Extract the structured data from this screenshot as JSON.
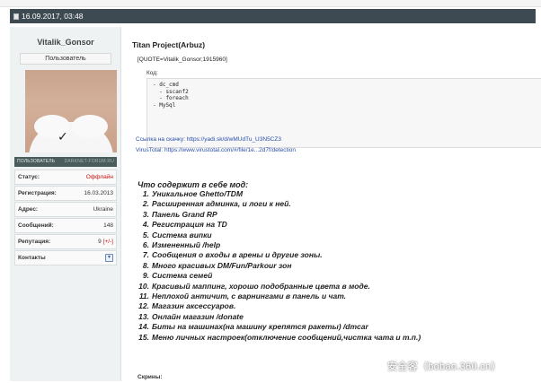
{
  "post_header": {
    "datetime": "16.09.2017, 03:48"
  },
  "user": {
    "name": "Vitalik_Gonsor",
    "role": "Пользователь",
    "banner": {
      "label": "ПОЛЬЗОВАТЕЛЬ",
      "brand": "DARKNET-FORUM.RU"
    },
    "info": [
      {
        "label": "Статус:",
        "value": "Оффлайн",
        "color": "#d01010"
      },
      {
        "label": "Регистрация:",
        "value": "16.03.2013"
      },
      {
        "label": "Адрес:",
        "value": "Ukraine"
      },
      {
        "label": "Сообщений:",
        "value": "148"
      },
      {
        "label": "Репутация:",
        "value": "9",
        "extra": "[+/-]"
      }
    ],
    "contacts_label": "Контакты"
  },
  "post": {
    "title": "Titan Project(Arbuz)",
    "quote": "[QUOTE=Vitalik_Gonsor;1915960]",
    "code_label": "Код:",
    "code_text": "- dc_cmd\n  - sscanf2\n  - foreach\n- MySql",
    "download_label": "Ссылка на скачку:",
    "download_url": "https://yadi.sk/d/wMUdTu_U3N5CZ3",
    "virustotal_label": "VirusTotal:",
    "virustotal_url": "https://www.virustotal.com/#/file/1e...2d7f/detection",
    "features_heading": "Что содержит в себе мод:",
    "features": [
      {
        "num": "1.",
        "text": "Уникальное Ghetto/TDM"
      },
      {
        "num": "2.",
        "text": "Расширенная админка, и логи к ней."
      },
      {
        "num": "3.",
        "text": "Панель Grand RP"
      },
      {
        "num": "4.",
        "text": "Регистрация на TD"
      },
      {
        "num": "5.",
        "text": "Система випки"
      },
      {
        "num": "6.",
        "text": "Измененный /help"
      },
      {
        "num": "7.",
        "text": "Сообщения о входы в арены и другие зоны."
      },
      {
        "num": "8.",
        "text": "Много красивых DM/Fun/Parkour зон"
      },
      {
        "num": "9.",
        "text": "Система семей"
      },
      {
        "num": "10.",
        "text": "Красивый маппинг, хорошо подобранные цвета в моде."
      },
      {
        "num": "11.",
        "text": "Неплохой античит, с варнингами в панель и чат."
      },
      {
        "num": "12.",
        "text": "Магазин аксессуаров."
      },
      {
        "num": "13.",
        "text": "Онлайн магазин /donate"
      },
      {
        "num": "14.",
        "text": "Биты на машинах(на машину крепятся ракеты) /dmcar"
      },
      {
        "num": "15.",
        "text": "Меню личных настроек(отключение сообщений,чистка чата и т.п.)"
      }
    ],
    "screens_label": "Скрины:"
  },
  "watermark": "安全客（bobao.360.cn）"
}
